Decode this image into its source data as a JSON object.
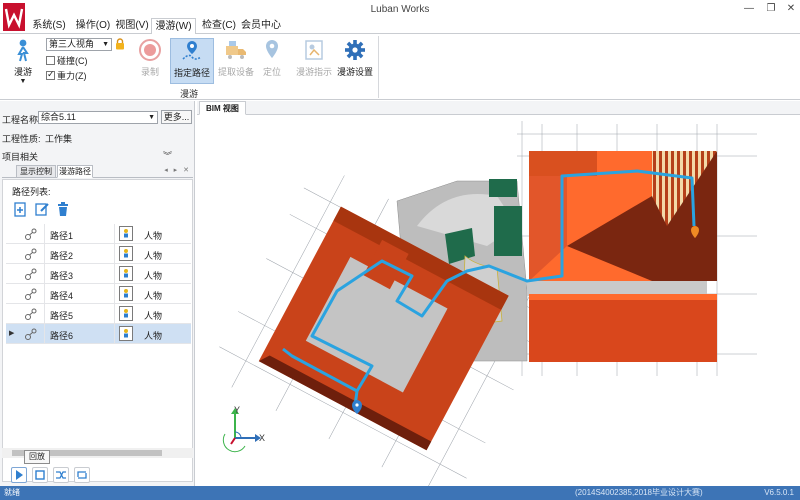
{
  "window": {
    "title": "Luban Works"
  },
  "menu": {
    "tabs": [
      {
        "label": "系统(S)"
      },
      {
        "label": "操作(O)"
      },
      {
        "label": "视图(V)"
      },
      {
        "label": "漫游(W)"
      },
      {
        "label": "检查(C)"
      },
      {
        "label": "会员中心"
      }
    ],
    "active_index": 3
  },
  "ribbon": {
    "roam_label": "漫游",
    "view_mode": "第三人视角",
    "collision_label": "碰撞(C)",
    "collision_checked": false,
    "gravity_label": "重力(Z)",
    "gravity_checked": true,
    "buttons": [
      {
        "label": "录制",
        "enabled": false
      },
      {
        "label": "指定路径",
        "enabled": true,
        "active": true
      },
      {
        "label": "提取设备",
        "enabled": false
      },
      {
        "label": "定位",
        "enabled": false
      },
      {
        "label": "漫游指示",
        "enabled": false
      },
      {
        "label": "漫游设置",
        "enabled": true
      }
    ],
    "group_label": "漫游"
  },
  "left": {
    "project_name_label": "工程名称:",
    "project_name_value": "综合5.11",
    "more_label": "更多...",
    "project_type_label": "工程性质:",
    "project_type_value": "工作集",
    "project_related_label": "项目相关",
    "tabs": [
      {
        "label": "显示控制"
      },
      {
        "label": "漫游路径"
      }
    ],
    "route_list_label": "路径列表:",
    "routes": [
      {
        "name": "路径1",
        "type": "人物"
      },
      {
        "name": "路径2",
        "type": "人物"
      },
      {
        "name": "路径3",
        "type": "人物"
      },
      {
        "name": "路径4",
        "type": "人物"
      },
      {
        "name": "路径5",
        "type": "人物"
      },
      {
        "name": "路径6",
        "type": "人物"
      }
    ],
    "selected_route_index": 5,
    "tooltip": "回放"
  },
  "viewport": {
    "tab_label": "BIM 视图",
    "axis_y": "Y",
    "axis_x": "X"
  },
  "status": {
    "left": "就绪",
    "middle": "(2014S4002385,2018毕业设计大赛)",
    "version": "V6.5.0.1"
  },
  "colors": {
    "accent": "#3d74b6",
    "roof_orange": "#e2562a",
    "roof_dark": "#7a2610",
    "path_blue": "#2aa3e0",
    "green_block": "#1f6b4b"
  }
}
